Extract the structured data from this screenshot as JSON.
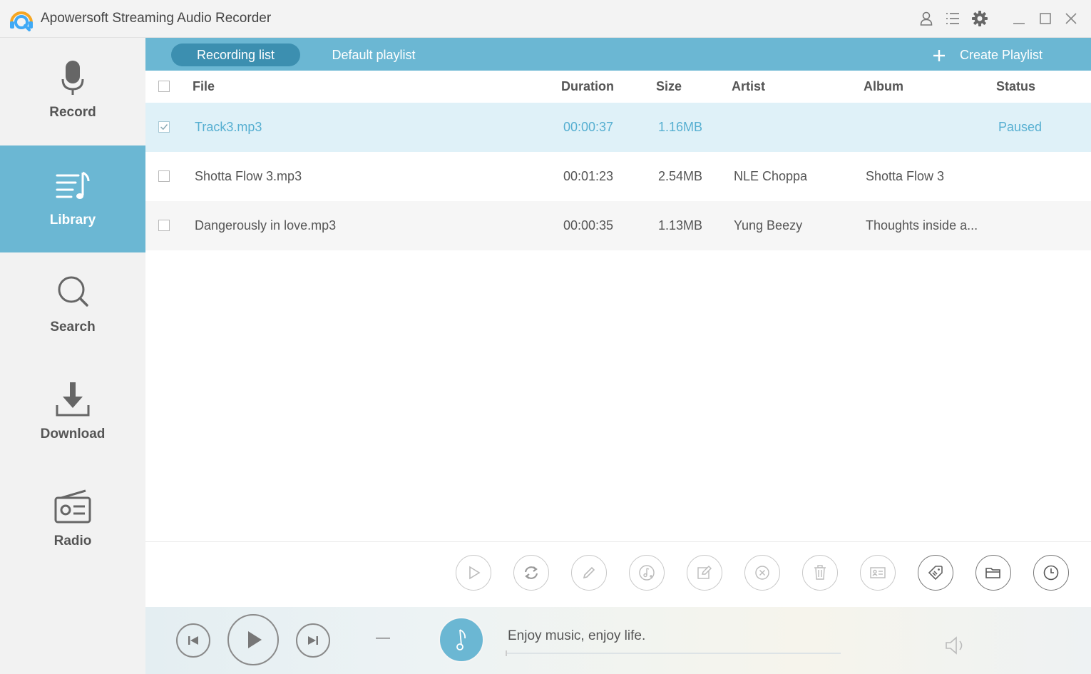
{
  "window": {
    "title": "Apowersoft Streaming Audio Recorder"
  },
  "sidebar": {
    "items": [
      {
        "label": "Record",
        "icon": "microphone-icon",
        "active": false
      },
      {
        "label": "Library",
        "icon": "library-icon",
        "active": true
      },
      {
        "label": "Search",
        "icon": "search-icon",
        "active": false
      },
      {
        "label": "Download",
        "icon": "download-icon",
        "active": false
      },
      {
        "label": "Radio",
        "icon": "radio-icon",
        "active": false
      }
    ]
  },
  "tabs": {
    "recording_list": "Recording list",
    "default_playlist": "Default playlist",
    "create_playlist": "Create Playlist"
  },
  "table": {
    "headers": {
      "file": "File",
      "duration": "Duration",
      "size": "Size",
      "artist": "Artist",
      "album": "Album",
      "status": "Status"
    },
    "rows": [
      {
        "file": "Track3.mp3",
        "duration": "00:00:37",
        "size": "1.16MB",
        "artist": "",
        "album": "",
        "status": "Paused",
        "checked": true
      },
      {
        "file": "Shotta Flow 3.mp3",
        "duration": "00:01:23",
        "size": "2.54MB",
        "artist": "NLE Choppa",
        "album": "Shotta Flow 3",
        "status": "",
        "checked": false
      },
      {
        "file": "Dangerously in love.mp3",
        "duration": "00:00:35",
        "size": "1.13MB",
        "artist": "Yung Beezy",
        "album": "Thoughts inside a...",
        "status": "",
        "checked": false
      }
    ]
  },
  "player": {
    "slogan": "Enjoy music, enjoy life.",
    "time_placeholder": "—",
    "progress": 0
  },
  "colors": {
    "accent": "#6bb7d3",
    "accent_dark": "#3c8fb0",
    "selected_row": "#dff1f8",
    "selected_text": "#56afd1"
  }
}
